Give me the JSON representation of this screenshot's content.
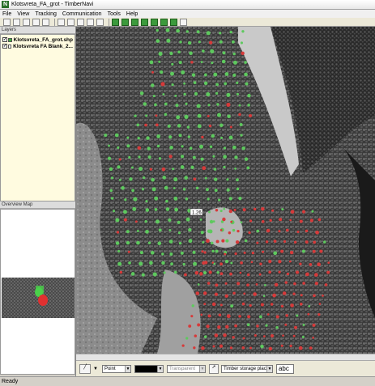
{
  "window": {
    "title": "Klotsvreta_FA_grot - TimberNavi"
  },
  "menu": [
    "File",
    "View",
    "Tracking",
    "Communication",
    "Tools",
    "Help"
  ],
  "layers": {
    "header": "Layers",
    "items": [
      {
        "name": "Klotsvreta_FA_grot.shp",
        "checked": true,
        "color": "#3fb33f"
      },
      {
        "name": "Klotsvreta FA Blank_2...",
        "checked": true,
        "color": "#ffffff"
      }
    ]
  },
  "overview": {
    "header": "Overview Map"
  },
  "map": {
    "label": "1.26",
    "green_color": "#5ec95e",
    "red_color": "#d63a3a"
  },
  "bottom": {
    "point_type": "Point",
    "transparency": "Transparent",
    "storage": "Timber storage plac",
    "text_tool": "abc"
  },
  "status": {
    "text": "Ready"
  }
}
